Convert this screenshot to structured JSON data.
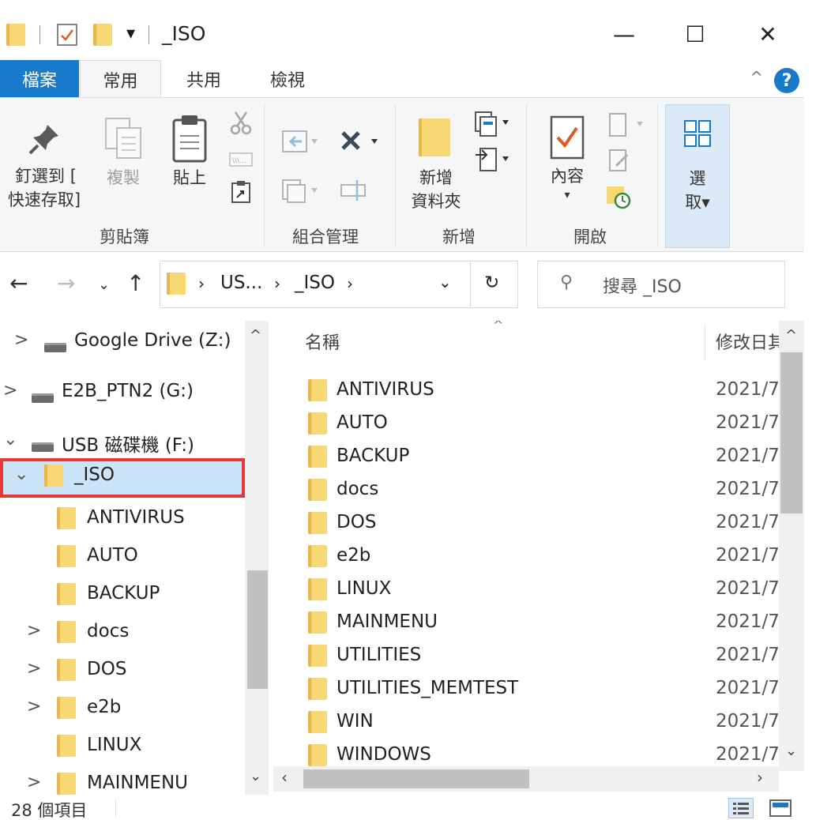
{
  "window": {
    "title": "_ISO",
    "minimize_glyph": "—",
    "maximize_glyph": "☐",
    "close_glyph": "✕"
  },
  "quick_access": {
    "dropdown_glyph": "▾"
  },
  "tabs": {
    "file": "檔案",
    "home": "常用",
    "share": "共用",
    "view": "檢視",
    "help": "?"
  },
  "ribbon": {
    "clipboard": {
      "group_label": "剪貼簿",
      "pin_line1": "釘選到 [",
      "pin_line2": "快速存取]",
      "copy": "複製",
      "paste": "貼上"
    },
    "organize": {
      "group_label": "組合管理"
    },
    "new": {
      "group_label": "新增",
      "new_folder_line1": "新增",
      "new_folder_line2": "資料夾"
    },
    "open": {
      "group_label": "開啟",
      "properties": "內容"
    },
    "select": {
      "line1": "選",
      "line2": "取▾"
    }
  },
  "address": {
    "segment1": "US...",
    "segment2": "_ISO",
    "search_placeholder": "搜尋 _ISO"
  },
  "nav_tree": [
    {
      "label": "Google Drive (Z:)",
      "type": "drive",
      "chevron": ">"
    },
    {
      "label": "E2B_PTN2 (G:)",
      "type": "drive",
      "chevron": ">"
    },
    {
      "label": "USB 磁碟機 (F:)",
      "type": "drive",
      "chevron": "⌄"
    },
    {
      "label": "_ISO",
      "type": "folder",
      "chevron": "⌄",
      "selected": true
    },
    {
      "label": "ANTIVIRUS",
      "type": "folder",
      "chevron": ""
    },
    {
      "label": "AUTO",
      "type": "folder",
      "chevron": ""
    },
    {
      "label": "BACKUP",
      "type": "folder",
      "chevron": ""
    },
    {
      "label": "docs",
      "type": "folder",
      "chevron": ">"
    },
    {
      "label": "DOS",
      "type": "folder",
      "chevron": ">"
    },
    {
      "label": "e2b",
      "type": "folder",
      "chevron": ">"
    },
    {
      "label": "LINUX",
      "type": "folder",
      "chevron": ""
    },
    {
      "label": "MAINMENU",
      "type": "folder",
      "chevron": ">"
    }
  ],
  "columns": {
    "name": "名稱",
    "modified": "修改日其"
  },
  "files": [
    {
      "name": "ANTIVIRUS",
      "date": "2021/7"
    },
    {
      "name": "AUTO",
      "date": "2021/7"
    },
    {
      "name": "BACKUP",
      "date": "2021/7"
    },
    {
      "name": "docs",
      "date": "2021/7"
    },
    {
      "name": "DOS",
      "date": "2021/7"
    },
    {
      "name": "e2b",
      "date": "2021/7"
    },
    {
      "name": "LINUX",
      "date": "2021/7"
    },
    {
      "name": "MAINMENU",
      "date": "2021/7"
    },
    {
      "name": "UTILITIES",
      "date": "2021/7"
    },
    {
      "name": "UTILITIES_MEMTEST",
      "date": "2021/7"
    },
    {
      "name": "WIN",
      "date": "2021/7"
    },
    {
      "name": "WINDOWS",
      "date": "2021/7"
    }
  ],
  "status": {
    "item_count": "28 個項目"
  },
  "colors": {
    "accent": "#1979ca",
    "selection": "#cce4f7",
    "highlight_border": "#e53935",
    "folder": "#f8d775"
  }
}
